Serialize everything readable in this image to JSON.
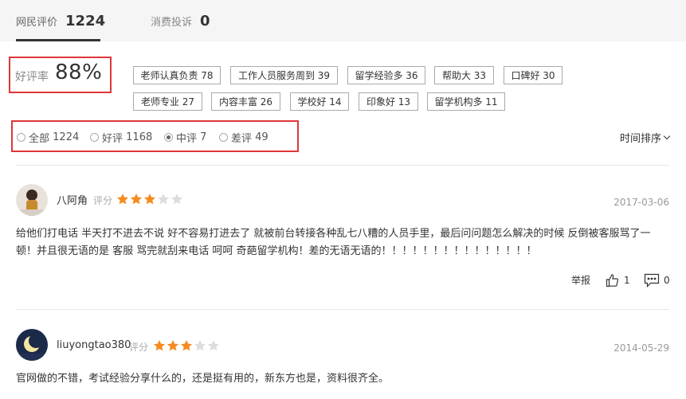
{
  "tabs": [
    {
      "label": "网民评价",
      "count": "1224"
    },
    {
      "label": "消费投诉",
      "count": "0"
    }
  ],
  "rating": {
    "label": "好评率",
    "value": "88%"
  },
  "tags": [
    {
      "label": "老师认真负责 78"
    },
    {
      "label": "工作人员服务周到 39"
    },
    {
      "label": "留学经验多 36"
    },
    {
      "label": "帮助大 33"
    },
    {
      "label": "口碑好 30"
    },
    {
      "label": "老师专业 27"
    },
    {
      "label": "内容丰富 26"
    },
    {
      "label": "学校好 14"
    },
    {
      "label": "印象好 13"
    },
    {
      "label": "留学机构多 11"
    }
  ],
  "filters": [
    {
      "label": "全部",
      "count": "1224",
      "selected": false
    },
    {
      "label": "好评",
      "count": "1168",
      "selected": false
    },
    {
      "label": "中评",
      "count": "7",
      "selected": true
    },
    {
      "label": "差评",
      "count": "49",
      "selected": false
    }
  ],
  "sort_label": "时间排序",
  "reviews": [
    {
      "username": "八阿角",
      "score_label": "评分",
      "stars": 3,
      "max_stars": 5,
      "date": "2017-03-06",
      "text": "给他们打电话 半天打不进去不说 好不容易打进去了 就被前台转接各种乱七八糟的人员手里，最后问问题怎么解决的时候 反倒被客服骂了一顿！并且很无语的是 客服 骂完就刮来电话 呵呵 奇葩留学机构！差的无语无语的！！！！！！！！！！！！！！！",
      "report_label": "举报",
      "likes": "1",
      "comments": "0"
    },
    {
      "username": "liuyongtao380",
      "score_label": "评分",
      "stars": 3,
      "max_stars": 5,
      "date": "2014-05-29",
      "text": "官网做的不错，考试经验分享什么的，还是挺有用的，新东方也是，资料很齐全。"
    }
  ],
  "colors": {
    "highlight_box": "#e0363b",
    "star_on": "#f58a1f",
    "star_off": "#dddddd"
  }
}
